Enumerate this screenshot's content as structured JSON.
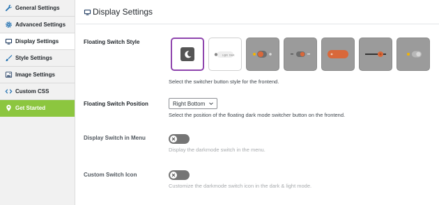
{
  "sidebar": {
    "items": [
      {
        "label": "General Settings"
      },
      {
        "label": "Advanced Settings"
      },
      {
        "label": "Display Settings"
      },
      {
        "label": "Style Settings"
      },
      {
        "label": "Image Settings"
      },
      {
        "label": "Custom CSS"
      },
      {
        "label": "Get Started"
      }
    ],
    "active_item": "Display Settings",
    "accent_color": "#8cc63f"
  },
  "header": {
    "title": "Display Settings"
  },
  "floating_style": {
    "label": "Floating Switch Style",
    "description": "Select the switcher button style for the frontend.",
    "selected_index": 0,
    "selected_border_color": "#8e44ad",
    "option_count": 7
  },
  "position": {
    "label": "Floating Switch Position",
    "value": "Right Bottom",
    "description": "Select the position of the floating dark mode switcher button on the frontend."
  },
  "menu_switch": {
    "label": "Display Switch in Menu",
    "description": "Display the darkmode switch in the menu.",
    "enabled": false
  },
  "custom_icon": {
    "label": "Custom Switch Icon",
    "description": "Customize the darkmode switch icon in the dark & light mode.",
    "enabled": false
  },
  "colors": {
    "orange_accent": "#d9683a",
    "toggle_off": "#757575"
  }
}
